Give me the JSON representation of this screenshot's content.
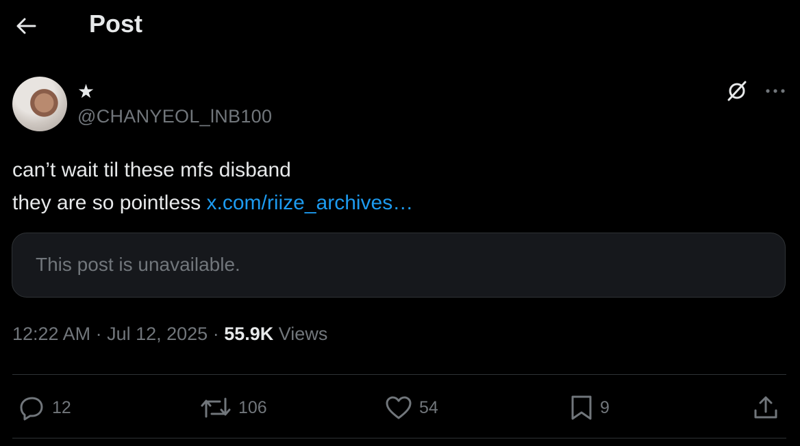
{
  "header": {
    "title": "Post"
  },
  "author": {
    "display_name": "★",
    "handle": "@CHANYEOL_lNB100"
  },
  "post": {
    "line1": "can’t wait til these mfs disband",
    "line2": "they are so pointless ",
    "link_text": "x.com/riize_archives…"
  },
  "quote": {
    "text": "This post is unavailable."
  },
  "meta": {
    "time": "12:22 AM",
    "date": "Jul 12, 2025",
    "views_count": "55.9K",
    "views_label": "Views",
    "separator": " · "
  },
  "actions": {
    "replies": "12",
    "reposts": "106",
    "likes": "54",
    "bookmarks": "9"
  },
  "colors": {
    "background": "#000000",
    "text": "#e7e9ea",
    "secondary": "#71767b",
    "link": "#1d9bf0",
    "border": "#2f3336",
    "card": "#16181c"
  }
}
